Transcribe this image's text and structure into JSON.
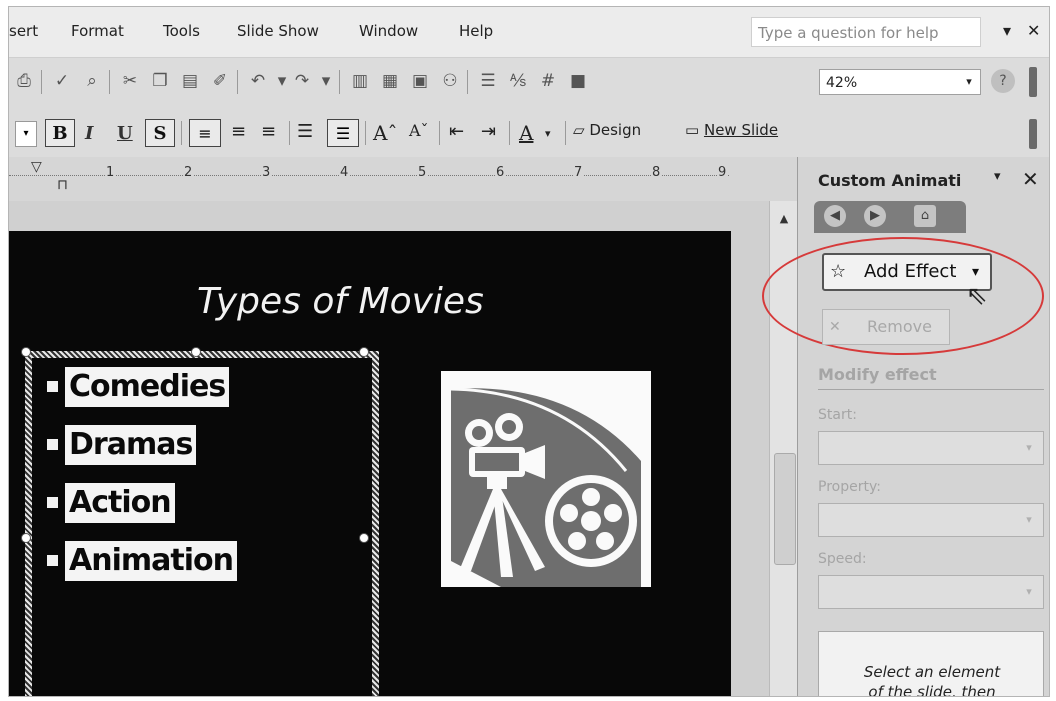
{
  "menu": {
    "items": [
      "sert",
      "Format",
      "Tools",
      "Slide Show",
      "Window",
      "Help"
    ],
    "help_placeholder": "Type a question for help",
    "help_dropdown": "▾",
    "close_glyph": "✕"
  },
  "toolbar": {
    "zoom_value": "42%",
    "zoom_arrow": "▾"
  },
  "formatting": {
    "bold": "B",
    "italic": "I",
    "underline": "U",
    "shadow": "S",
    "design_label": "Design",
    "new_slide_label": "New Slide"
  },
  "ruler": {
    "ticks": [
      "1",
      "2",
      "3",
      "4",
      "5",
      "6",
      "7",
      "8",
      "9"
    ]
  },
  "slide": {
    "title": "Types of Movies",
    "bullets": [
      "Comedies",
      "Dramas",
      "Action",
      "Animation"
    ]
  },
  "pane": {
    "title": "Custom Animati",
    "menu_glyph": "▾",
    "close_glyph": "✕",
    "add_effect_label": "Add Effect",
    "add_effect_arrow": "▾",
    "remove_label": "Remove",
    "modify_heading": "Modify effect",
    "start_label": "Start:",
    "property_label": "Property:",
    "speed_label": "Speed:",
    "note_line1": "Select an element",
    "note_line2": "of the slide, then"
  },
  "colors": {
    "highlight_oval": "#d63a3a",
    "slide_background": "#080808"
  }
}
